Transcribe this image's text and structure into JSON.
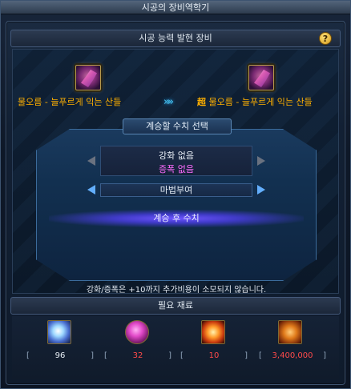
{
  "window": {
    "title": "시공의 장비역학기"
  },
  "panel": {
    "title": "시공 능력 발현 장비",
    "help_label": "?"
  },
  "source_item": {
    "name": "물오름 - 늘푸르게 익는 산들"
  },
  "target_item": {
    "prefix": "超",
    "name": "물오름 - 늘푸르게 익는 산들"
  },
  "arrows": "»»",
  "selection": {
    "title": "계승할 수치 선택",
    "line1": "강화 없음",
    "line2": "증폭 없음",
    "option": "마법부여",
    "inherit_label": "계승 후 수치"
  },
  "notice": "강화/증폭은 +10까지 추가비용이 소모되지 않습니다.",
  "materials": {
    "title": "필요 재료",
    "items": [
      {
        "icon": "crystal-icon",
        "count": "96",
        "status": "ok"
      },
      {
        "icon": "orb-icon",
        "count": "32",
        "status": "lack"
      },
      {
        "icon": "sun-core-icon",
        "count": "10",
        "status": "lack"
      },
      {
        "icon": "gold-icon",
        "count": "3,400,000",
        "status": "lack"
      }
    ]
  },
  "colors": {
    "item_name": "#ffb000",
    "amplify": "#ff6bff",
    "lack": "#ff4a4a",
    "accent": "#4bd2ff"
  }
}
